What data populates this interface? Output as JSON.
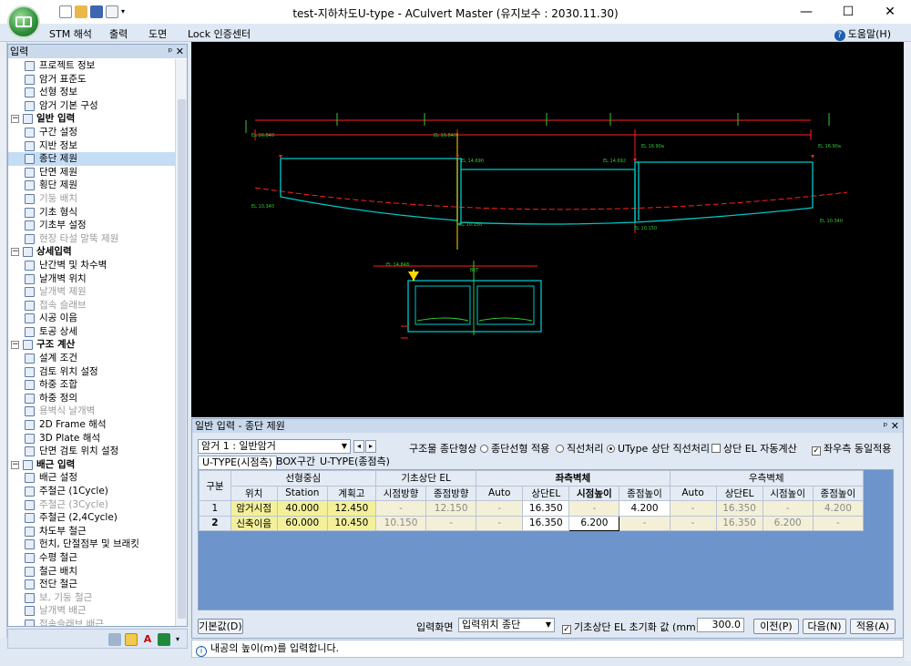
{
  "window": {
    "title": "test-지하차도U-type - ACulvert Master (유지보수 : 2030.11.30)",
    "controls": [
      "—",
      "☐",
      "✕"
    ]
  },
  "menu": {
    "items": [
      "STM 해석",
      "출력",
      "도면",
      "Lock 인증센터"
    ],
    "help": "도움말(H)"
  },
  "left_panel": {
    "title": "입력",
    "pin": "ᵖ ✕",
    "items": [
      {
        "label": "프로젝트 정보",
        "type": "item",
        "icon": "project-info-icon"
      },
      {
        "label": "암거 표준도",
        "type": "item",
        "icon": "standard-drawing-icon"
      },
      {
        "label": "선형 정보",
        "type": "item",
        "icon": "alignment-icon"
      },
      {
        "label": "암거 기본 구성",
        "type": "item",
        "icon": "basic-config-icon"
      },
      {
        "label": "일반 입력",
        "type": "category"
      },
      {
        "label": "구간 설정",
        "type": "item",
        "icon": "section-icon"
      },
      {
        "label": "지반 정보",
        "type": "item",
        "icon": "ground-icon"
      },
      {
        "label": "종단 제원",
        "type": "item",
        "icon": "longitudinal-icon",
        "selected": true
      },
      {
        "label": "단면 제원",
        "type": "item",
        "icon": "cross-section-icon"
      },
      {
        "label": "횡단 제원",
        "type": "item",
        "icon": "transverse-icon"
      },
      {
        "label": "기둥 배치",
        "type": "item",
        "icon": "column-icon",
        "disabled": true
      },
      {
        "label": "기초 형식",
        "type": "item",
        "icon": "foundation-icon"
      },
      {
        "label": "기초부 설정",
        "type": "item",
        "icon": "foundation-setting-icon"
      },
      {
        "label": "현장 타설 말뚝 제원",
        "type": "item",
        "icon": "pile-icon",
        "disabled": true
      },
      {
        "label": "상세입력",
        "type": "category"
      },
      {
        "label": "난간벽 및 차수벽",
        "type": "item",
        "icon": "parapet-icon"
      },
      {
        "label": "날개벽 위치",
        "type": "item",
        "icon": "wingwall-position-icon"
      },
      {
        "label": "날개벽 제원",
        "type": "item",
        "icon": "wingwall-spec-icon",
        "disabled": true
      },
      {
        "label": "접속 슬래브",
        "type": "item",
        "icon": "approach-slab-icon",
        "disabled": true
      },
      {
        "label": "시공 이음",
        "type": "item",
        "icon": "construction-joint-icon"
      },
      {
        "label": "토공 상세",
        "type": "item",
        "icon": "earthwork-icon"
      },
      {
        "label": "구조 계산",
        "type": "category"
      },
      {
        "label": "설계 조건",
        "type": "item",
        "icon": "design-condition-icon"
      },
      {
        "label": "검토 위치 설정",
        "type": "item",
        "icon": "check-position-icon"
      },
      {
        "label": "하중 조합",
        "type": "item",
        "icon": "load-combination-icon"
      },
      {
        "label": "하중 정의",
        "type": "item",
        "icon": "load-definition-icon"
      },
      {
        "label": "용벽식 날개벽",
        "type": "item",
        "icon": "retaining-wingwall-icon",
        "disabled": true
      },
      {
        "label": "2D Frame 해석",
        "type": "item",
        "icon": "frame-2d-icon"
      },
      {
        "label": "3D Plate 해석",
        "type": "item",
        "icon": "plate-3d-icon"
      },
      {
        "label": "단면 검토 위치 설정",
        "type": "item",
        "icon": "section-check-icon"
      },
      {
        "label": "배근 입력",
        "type": "category"
      },
      {
        "label": "배근 설정",
        "type": "item",
        "icon": "rebar-setting-icon"
      },
      {
        "label": "주철근 (1Cycle)",
        "type": "item",
        "icon": "main-rebar-1-icon"
      },
      {
        "label": "주철근 (3Cycle)",
        "type": "item",
        "icon": "main-rebar-3-icon",
        "disabled": true
      },
      {
        "label": "주철근 (2,4Cycle)",
        "type": "item",
        "icon": "main-rebar-24-icon"
      },
      {
        "label": "차도부 철근",
        "type": "item",
        "icon": "roadway-rebar-icon"
      },
      {
        "label": "헌치, 단절점부 및 브래킷",
        "type": "item",
        "icon": "haunch-icon"
      },
      {
        "label": "수평 철근",
        "type": "item",
        "icon": "horizontal-rebar-icon"
      },
      {
        "label": "철근 배치",
        "type": "item",
        "icon": "rebar-layout-icon"
      },
      {
        "label": "전단 철근",
        "type": "item",
        "icon": "shear-rebar-icon"
      },
      {
        "label": "보, 기둥 철근",
        "type": "item",
        "icon": "beam-column-rebar-icon",
        "disabled": true
      },
      {
        "label": "날개벽 배근",
        "type": "item",
        "icon": "wingwall-rebar-icon",
        "disabled": true
      },
      {
        "label": "접속슬래브 배근",
        "type": "item",
        "icon": "approach-slab-rebar-icon",
        "disabled": true
      }
    ]
  },
  "drawing": {
    "top_labels": [
      "EL 16.840",
      "EL 16.840",
      "EL 14.690",
      "EL 16.350",
      "EL 14.692",
      "EL 16.90a",
      "EL 16.90a"
    ],
    "left_label": "EL 10.340",
    "bottom_labels": [
      "EL 10.340",
      "EL 10.150",
      "EL 10.340",
      "EL 10.150"
    ],
    "section_label": "EL 14.848",
    "section_center": "BYT",
    "accent": "#00c8c8",
    "red": "#ff2020",
    "yellow": "#ffd800",
    "green": "#33cc33"
  },
  "dialog": {
    "title": "일반 입력 - 종단 제원",
    "box_select": "암거 1 : 일반암거",
    "shape_label": "구조물 종단형상",
    "radio_options": [
      {
        "label": "종단선형 적용",
        "checked": false
      },
      {
        "label": "직선처리",
        "checked": false
      },
      {
        "label": "UType 상단 직선처리",
        "checked": true
      }
    ],
    "auto_el": {
      "label": "상단 EL 자동계산",
      "checked": false
    },
    "lr_same": {
      "label": "좌우측 동일적용",
      "checked": true
    },
    "tabs": [
      "U-TYPE(시점측)",
      "BOX구간",
      "U-TYPE(종점측)"
    ],
    "table": {
      "group_headers": [
        "구분",
        "선형중심",
        "기초상단 EL",
        "좌측벽체",
        "우측벽체"
      ],
      "sub_headers": [
        "위치",
        "Station",
        "계획고",
        "시점방향",
        "종점방향",
        "Auto",
        "상단EL",
        "시점높이",
        "종점높이",
        "Auto",
        "상단EL",
        "시점높이",
        "종점높이"
      ],
      "rows": [
        [
          "1",
          "암거시점",
          "40.000",
          "12.450",
          "-",
          "12.150",
          "-",
          "16.350",
          "-",
          "4.200",
          "-",
          "16.350",
          "-",
          "4.200"
        ],
        [
          "2",
          "신축이음",
          "60.000",
          "10.450",
          "10.150",
          "-",
          "-",
          "16.350",
          "6.200",
          "-",
          "-",
          "16.350",
          "6.200",
          "-"
        ]
      ]
    },
    "default_btn": "기본값(D)",
    "input_screen_label": "입력화면",
    "input_screen_value": "입력위치 종단",
    "reset_check": {
      "label": "기초상단 EL 초기화 값 (mm)",
      "checked": true
    },
    "reset_value": "300.0",
    "prev_btn": "이전(P)",
    "next_btn": "다음(N)",
    "apply_btn": "적용(A)"
  },
  "status": {
    "text": "내공의 높이(m)를 입력합니다."
  }
}
